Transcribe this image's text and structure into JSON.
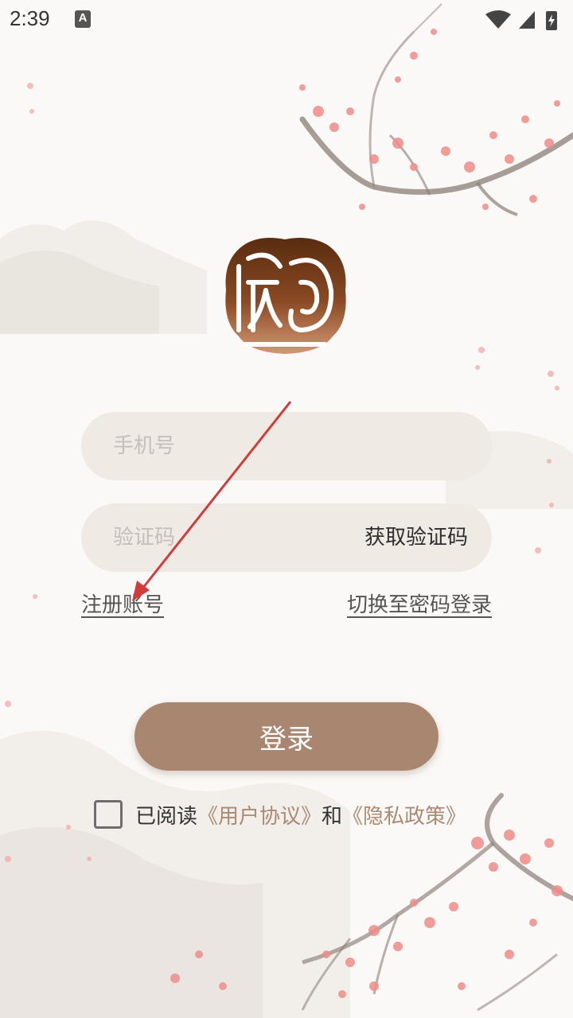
{
  "status_bar": {
    "time": "2:39",
    "notification_icon": "A",
    "icons": [
      "wifi-icon",
      "signal-icon",
      "battery-charging-icon"
    ]
  },
  "login_form": {
    "phone_placeholder": "手机号",
    "code_placeholder": "验证码",
    "get_code_label": "获取验证码",
    "register_link": "注册账号",
    "switch_link": "切换至密码登录",
    "login_button": "登录"
  },
  "agreement": {
    "prefix": "已阅读",
    "user_agreement": "《用户协议》",
    "conjunction": "和",
    "privacy_policy": "《隐私政策》"
  },
  "colors": {
    "accent": "#a88670",
    "link_accent": "#a98a72",
    "field_bg": "#efeae4",
    "annotation_arrow": "#d23b3b"
  }
}
